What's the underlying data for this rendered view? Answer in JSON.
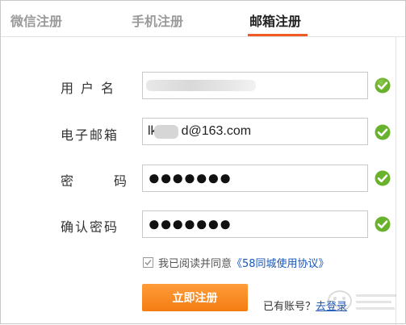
{
  "tabs": [
    {
      "label": "微信注册",
      "active": false
    },
    {
      "label": "手机注册",
      "active": false
    },
    {
      "label": "邮箱注册",
      "active": true
    }
  ],
  "form": {
    "username": {
      "label": "用户名",
      "value": ""
    },
    "email": {
      "label": "电子邮箱",
      "value_prefix": "lk",
      "value_suffix": "d@163.com"
    },
    "password": {
      "label": "密码",
      "value": "●●●●●●●"
    },
    "confirm": {
      "label": "确认密码",
      "value": "●●●●●●●"
    }
  },
  "agreement": {
    "checked": true,
    "text": "我已阅读并同意",
    "link": "《58同城使用协议》"
  },
  "submit_label": "立即注册",
  "login": {
    "prompt": "已有账号？",
    "link": "去登录"
  },
  "colors": {
    "accent": "#f05a22",
    "button": "#f47d12",
    "link": "#1a56b8",
    "check": "#69b22b"
  }
}
